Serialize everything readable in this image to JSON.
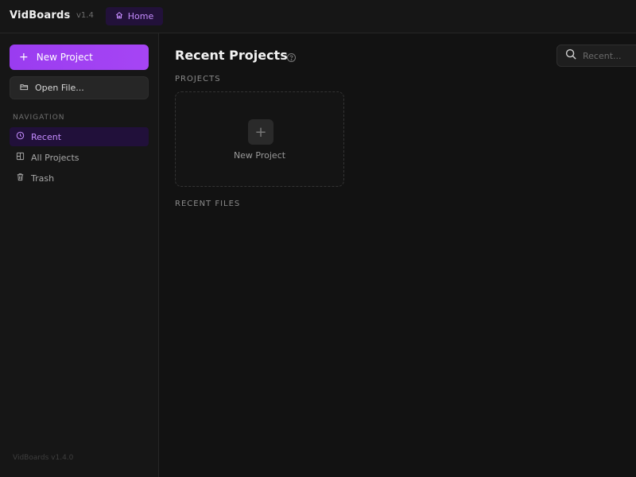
{
  "app": {
    "name": "VidBoards",
    "version": "v1.4",
    "footer_version": "VidBoards v1.4.0"
  },
  "topbar": {
    "home_label": "Home"
  },
  "sidebar": {
    "new_project_label": "New Project",
    "open_file_label": "Open File...",
    "nav_heading": "NAVIGATION",
    "items": [
      {
        "label": "Recent",
        "icon": "clock-icon",
        "active": true
      },
      {
        "label": "All Projects",
        "icon": "grid-icon",
        "active": false
      },
      {
        "label": "Trash",
        "icon": "trash-icon",
        "active": false
      }
    ]
  },
  "main": {
    "title": "Recent Projects",
    "search_placeholder": "Recent...",
    "projects_label": "PROJECTS",
    "new_card_label": "New Project",
    "recent_files_label": "RECENT FILES"
  },
  "colors": {
    "accent": "#a645f4",
    "accent_text": "#c58cff",
    "background": "#121212",
    "sidebar_bg": "#161616"
  }
}
